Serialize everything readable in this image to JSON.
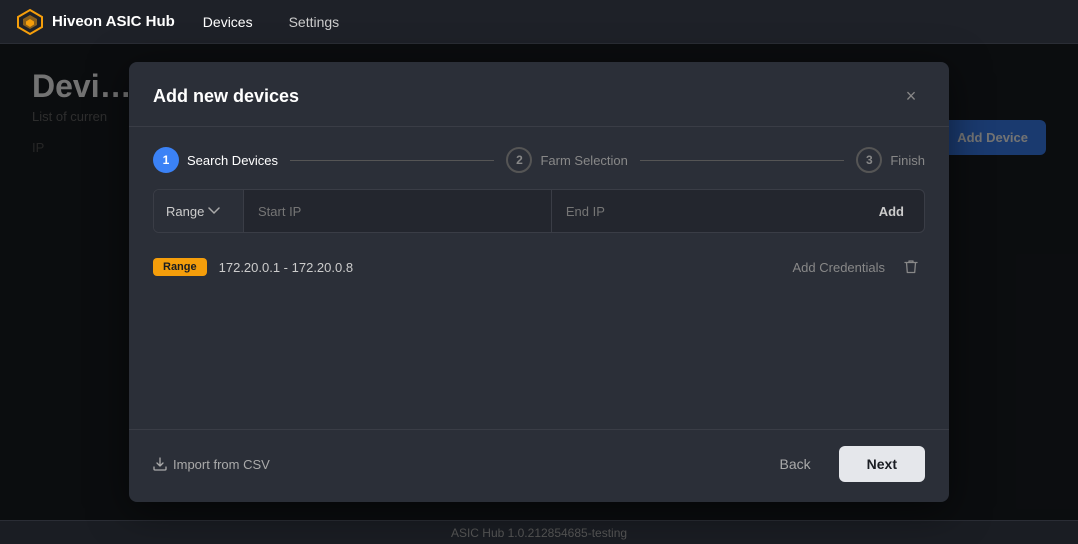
{
  "app": {
    "name": "Hiveon ASIC Hub",
    "nav_items": [
      "Devices",
      "Settings"
    ]
  },
  "page": {
    "title": "Devi",
    "subtitle": "List of curren",
    "add_device_label": "Add Device"
  },
  "modal": {
    "title": "Add new devices",
    "close_label": "×",
    "steps": [
      {
        "number": "1",
        "label": "Search Devices",
        "state": "active"
      },
      {
        "number": "2",
        "label": "Farm Selection",
        "state": "inactive"
      },
      {
        "number": "3",
        "label": "Finish",
        "state": "inactive"
      }
    ],
    "range_select_label": "Range",
    "start_ip_placeholder": "Start IP",
    "end_ip_placeholder": "End IP",
    "add_label": "Add",
    "entry": {
      "badge": "Range",
      "ips": "172.20.0.1 - 172.20.0.8",
      "credentials_label": "Add Credentials"
    },
    "footer": {
      "import_label": "Import from CSV",
      "back_label": "Back",
      "next_label": "Next"
    }
  },
  "statusbar": {
    "text": "ASIC Hub 1.0.212854685-testing"
  },
  "table": {
    "ip_header": "IP"
  }
}
